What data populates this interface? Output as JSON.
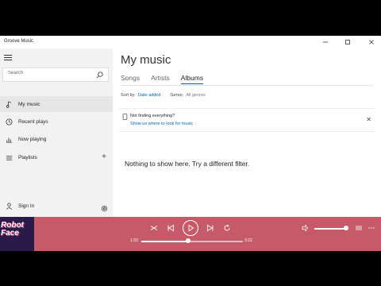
{
  "window": {
    "title": "Groove Music"
  },
  "sidebar": {
    "search_placeholder": "Search",
    "items": [
      {
        "label": "My music",
        "icon": "music-note-icon"
      },
      {
        "label": "Recent plays",
        "icon": "clock-icon"
      },
      {
        "label": "Now playing",
        "icon": "bar-chart-icon"
      },
      {
        "label": "Playlists",
        "icon": "playlist-icon"
      }
    ],
    "sign_in": "Sign In"
  },
  "main": {
    "title": "My music",
    "tabs": [
      {
        "label": "Songs"
      },
      {
        "label": "Artists"
      },
      {
        "label": "Albums"
      }
    ],
    "active_tab": "Albums",
    "filters": {
      "sort_label": "Sort by:",
      "sort_value": "Date added",
      "genre_label": "Genre:",
      "genre_value": "All genres"
    },
    "notice": {
      "title": "Not finding everything?",
      "link": "Show us where to look for music"
    },
    "empty_message": "Nothing to show here. Try a different filter."
  },
  "player": {
    "album_art_text": "Robot\nFace",
    "time_elapsed": "1:33",
    "time_total": "3:22",
    "progress": 0.46,
    "volume": 1.0
  },
  "colors": {
    "accent": "#0063b1",
    "player_bg": "#c65a68",
    "sidebar_bg": "#f2f2f2"
  }
}
